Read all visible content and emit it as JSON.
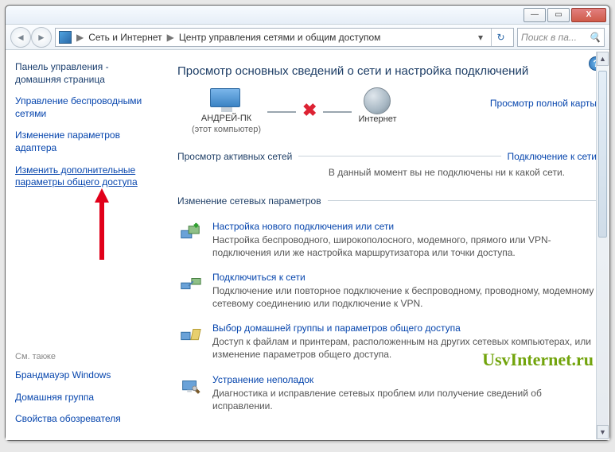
{
  "titlebar": {
    "min": "—",
    "max": "▭",
    "close": "X"
  },
  "address": {
    "seg1": "Сеть и Интернет",
    "seg2": "Центр управления сетями и общим доступом",
    "sep": "▶",
    "drop": "▾",
    "refresh": "↻"
  },
  "search": {
    "placeholder": "Поиск в па..."
  },
  "sidebar": {
    "home": "Панель управления - домашняя страница",
    "wireless": "Управление беспроводными сетями",
    "adapter": "Изменение параметров адаптера",
    "advshare": "Изменить дополнительные параметры общего доступа",
    "also_hdr": "См. также",
    "also1": "Брандмауэр Windows",
    "also2": "Домашняя группа",
    "also3": "Свойства обозревателя"
  },
  "main": {
    "heading": "Просмотр основных сведений о сети и настройка подключений",
    "map_full": "Просмотр полной карты",
    "node_pc": "АНДРЕЙ-ПК",
    "node_pc_sub": "(этот компьютер)",
    "node_net": "Интернет",
    "active_hdr": "Просмотр активных сетей",
    "connect_link": "Подключение к сети",
    "active_none": "В данный момент вы не подключены ни к какой сети.",
    "change_hdr": "Изменение сетевых параметров"
  },
  "items": [
    {
      "title": "Настройка нового подключения или сети",
      "desc": "Настройка беспроводного, широкополосного, модемного, прямого или VPN-подключения или же настройка маршрутизатора или точки доступа."
    },
    {
      "title": "Подключиться к сети",
      "desc": "Подключение или повторное подключение к беспроводному, проводному, модемному сетевому соединению или подключение к VPN."
    },
    {
      "title": "Выбор домашней группы и параметров общего доступа",
      "desc": "Доступ к файлам и принтерам, расположенным на других сетевых компьютерах, или изменение параметров общего доступа."
    },
    {
      "title": "Устранение неполадок",
      "desc": "Диагностика и исправление сетевых проблем или получение сведений об исправлении."
    }
  ],
  "watermark": "UsvInternet.ru"
}
